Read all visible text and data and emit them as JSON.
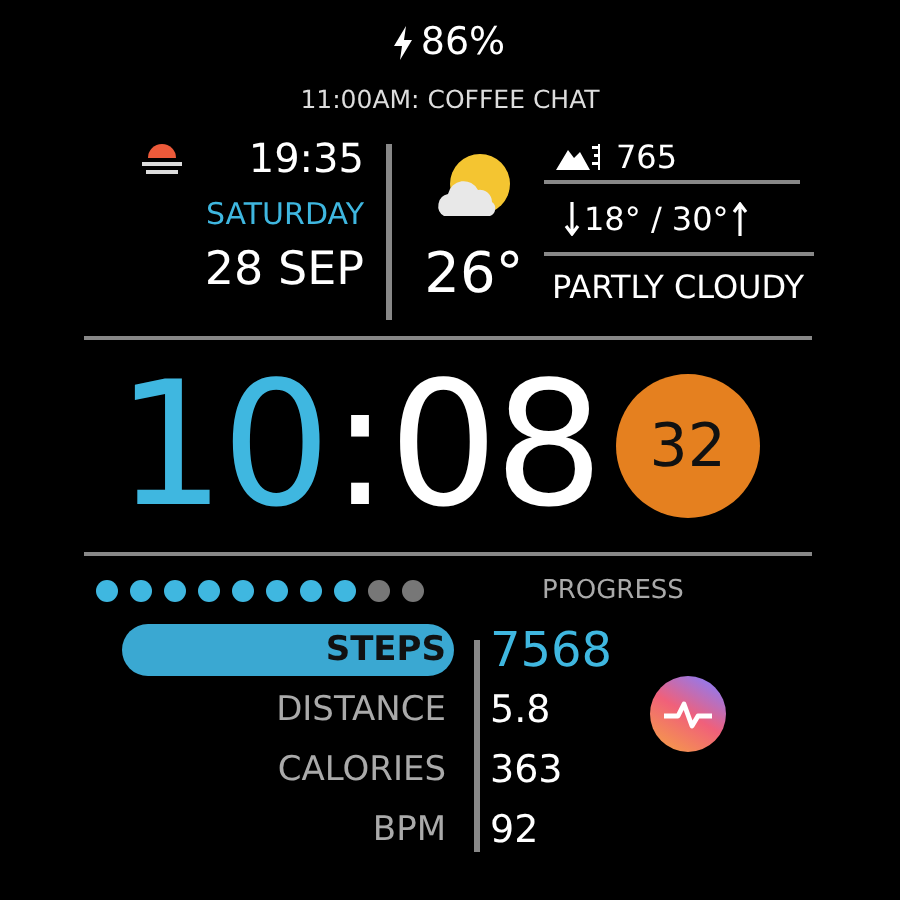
{
  "battery": {
    "charging": true,
    "text": "86%"
  },
  "event": "11:00AM: COFFEE CHAT",
  "sunset": {
    "time": "19:35"
  },
  "date": {
    "weekday": "SATURDAY",
    "day": "28 SEP"
  },
  "weather": {
    "temperature": "26°",
    "altitude": "765",
    "range": "18° / 30°",
    "condition": "PARTLY CLOUDY"
  },
  "clock": {
    "hours": "10",
    "separator": ":",
    "minutes": "08",
    "badge": "32"
  },
  "progress": {
    "label": "PROGRESS",
    "level": 0.8
  },
  "stats": [
    {
      "label": "STEPS",
      "value": "7568",
      "selected": true
    },
    {
      "label": "DISTANCE",
      "value": "5.8",
      "selected": false
    },
    {
      "label": "CALORIES",
      "value": "363",
      "selected": false
    },
    {
      "label": "BPM",
      "value": "92",
      "selected": false
    }
  ]
}
